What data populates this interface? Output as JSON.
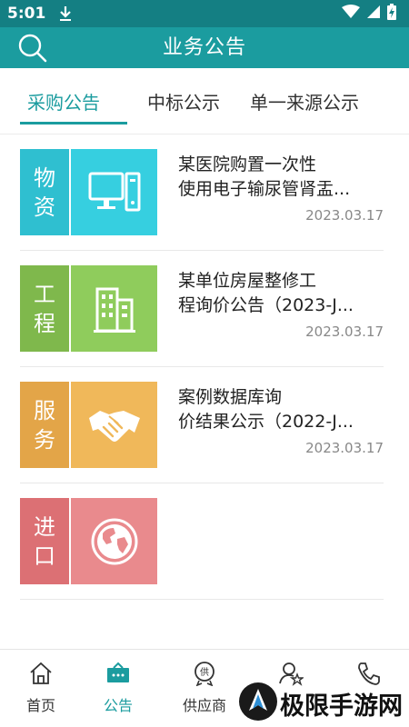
{
  "status_bar": {
    "time": "5:01",
    "icons": [
      "download-icon",
      "wifi-icon",
      "signal-icon",
      "battery-icon"
    ]
  },
  "app_bar": {
    "title": "业务公告",
    "search_icon": "search-icon"
  },
  "tabs": [
    {
      "label": "采购公告",
      "active": true
    },
    {
      "label": "中标公示",
      "active": false
    },
    {
      "label": "单一来源公示",
      "active": false
    }
  ],
  "items": [
    {
      "category_top": "物",
      "category_bottom": "资",
      "icon": "computer-icon",
      "color": "#2fbfd0",
      "title_line1": "某医院购置一次性",
      "title_line2": "使用电子输尿管肾盂...",
      "date": "2023.03.17"
    },
    {
      "category_top": "工",
      "category_bottom": "程",
      "icon": "building-icon",
      "color": "#88c057",
      "title_line1": "某单位房屋整修工",
      "title_line2": "程询价公告（2023-J...",
      "date": "2023.03.17"
    },
    {
      "category_top": "服",
      "category_bottom": "务",
      "icon": "handshake-icon",
      "color": "#ecb04f",
      "title_line1": "案例数据库询",
      "title_line2": "价结果公示（2022-J...",
      "date": "2023.03.17"
    },
    {
      "category_top": "进",
      "category_bottom": "口",
      "icon": "globe-icon",
      "color": "#e67f83",
      "title_line1": "",
      "title_line2": "",
      "date": ""
    }
  ],
  "bottom_nav": [
    {
      "label": "首页",
      "icon": "home-icon",
      "active": false
    },
    {
      "label": "公告",
      "icon": "announcement-icon",
      "active": true
    },
    {
      "label": "供应商",
      "icon": "supplier-icon",
      "active": false
    },
    {
      "label": "",
      "icon": "user-star-icon",
      "active": false
    },
    {
      "label": "",
      "icon": "phone-icon",
      "active": false
    }
  ],
  "watermark": {
    "text": "极限手游网"
  },
  "colors": {
    "primary": "#1b9c9f",
    "status_bar": "#147f83"
  }
}
